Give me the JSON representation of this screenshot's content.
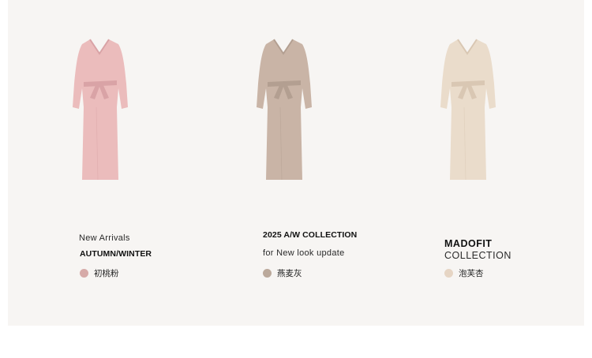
{
  "products": [
    {
      "line1": "New Arrivals",
      "line2": "AUTUMN/WINTER",
      "color_name": "初桃粉",
      "swatch_color": "#d6aaa8",
      "dress_color": "#ebbcbc",
      "dress_shade": "#d9a3a6"
    },
    {
      "line1": "2025 A/W COLLECTION",
      "line2": "for New look update",
      "color_name": "燕麦灰",
      "swatch_color": "#bba99b",
      "dress_color": "#c9b4a6",
      "dress_shade": "#b39f91"
    },
    {
      "line1": "MADOFIT",
      "line2": "COLLECTION",
      "color_name": "泡芙杏",
      "swatch_color": "#e6d5c4",
      "dress_color": "#eadccb",
      "dress_shade": "#d9c7b3"
    }
  ]
}
